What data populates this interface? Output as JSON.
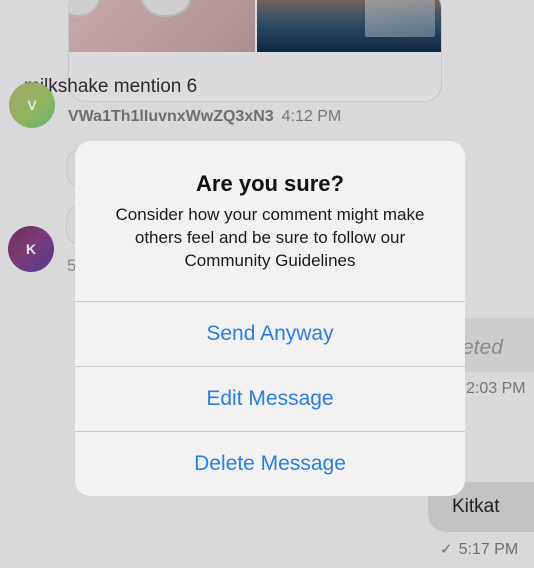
{
  "chat": {
    "top_message": {
      "text": "milkshake mention 6"
    },
    "sender": {
      "avatar_letter": "V",
      "name": "VWa1Th1lIuvnxWwZQ3xN3",
      "time": "4:12 PM"
    },
    "second_avatar_letter": "K",
    "obscured_count": "5",
    "right_message": {
      "text_fragment": "eted",
      "time_fragment": "2:03 PM"
    },
    "last_message": {
      "text": "Kitkat",
      "time": "5:17 PM",
      "status_icon": "checkmark-icon"
    }
  },
  "dialog": {
    "title": "Are you sure?",
    "message": "Consider how your comment might make others feel and be sure to follow our Community Guidelines",
    "buttons": {
      "send": "Send Anyway",
      "edit": "Edit Message",
      "delete": "Delete Message"
    },
    "accent_color": "#2a7de1"
  }
}
